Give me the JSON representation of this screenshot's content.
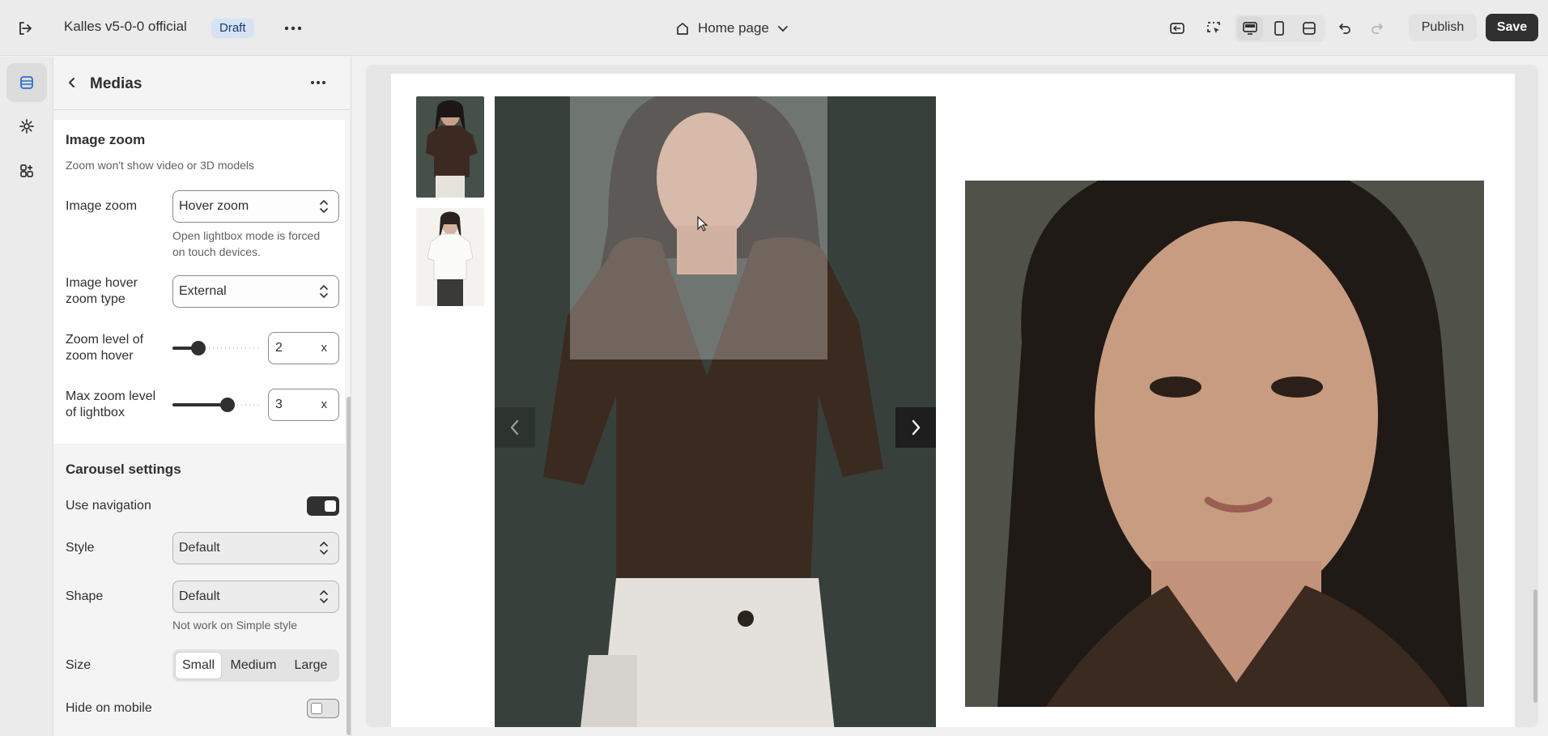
{
  "topbar": {
    "store_name": "Kalles v5-0-0 official",
    "status_badge": "Draft",
    "page_selector": "Home page",
    "publish_label": "Publish",
    "save_label": "Save"
  },
  "panel": {
    "title": "Medias",
    "image_zoom": {
      "section_title": "Image zoom",
      "section_hint": "Zoom won't show video or 3D models",
      "zoom_label": "Image zoom",
      "zoom_value": "Hover zoom",
      "zoom_help_line1": "Open lightbox mode is forced",
      "zoom_help_line2": "on touch devices.",
      "hover_type_label_line1": "Image hover",
      "hover_type_label_line2": "zoom type",
      "hover_type_value": "External",
      "zoom_level_label_line1": "Zoom level of",
      "zoom_level_label_line2": "zoom hover",
      "zoom_level_value": "2",
      "zoom_level_slider": 0.25,
      "max_zoom_label_line1": "Max zoom level",
      "max_zoom_label_line2": "of lightbox",
      "max_zoom_value": "3",
      "max_zoom_slider": 0.65,
      "unit": "x"
    },
    "carousel": {
      "section_title": "Carousel settings",
      "use_navigation_label": "Use navigation",
      "use_navigation_on": true,
      "style_label": "Style",
      "style_value": "Default",
      "shape_label": "Shape",
      "shape_value": "Default",
      "shape_help": "Not work on Simple style",
      "size_label": "Size",
      "size_options": [
        "Small",
        "Medium",
        "Large"
      ],
      "size_selected": "Small",
      "hide_mobile_label": "Hide on mobile",
      "hide_mobile_on": false
    }
  }
}
